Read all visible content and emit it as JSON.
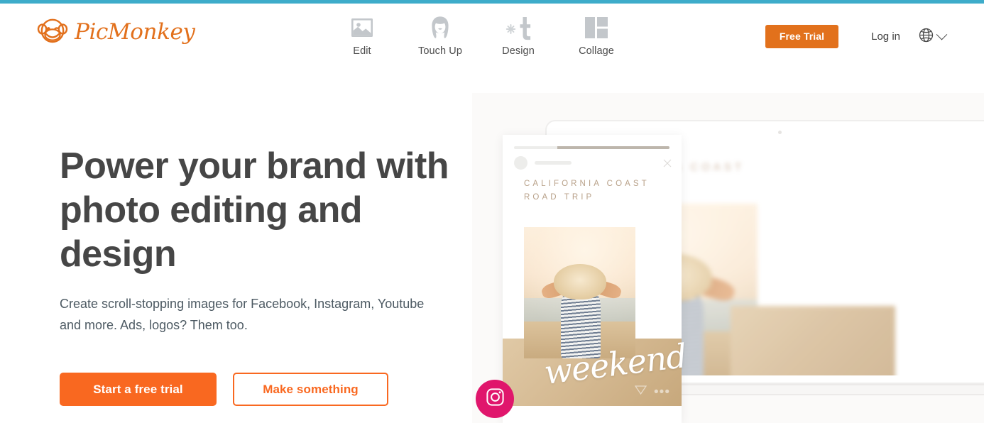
{
  "theme": {
    "accent_bar": "#3eacca",
    "brand_orange": "#F96820",
    "header_orange": "#e2711c",
    "logo_orange": "#e2701c",
    "instagram_pink": "#e0166c",
    "heading_gray": "#464646",
    "nav_icon_gray": "#c3c7cb"
  },
  "header": {
    "logo": {
      "text": "PicMonkey",
      "icon": "monkey-face-icon"
    },
    "nav": [
      {
        "label": "Edit",
        "icon": "image-photo-icon"
      },
      {
        "label": "Touch Up",
        "icon": "face-portrait-icon"
      },
      {
        "label": "Design",
        "icon": "asterisk-t-icon"
      },
      {
        "label": "Collage",
        "icon": "grid-panels-icon"
      }
    ],
    "free_trial_label": "Free Trial",
    "login_label": "Log in",
    "language": {
      "icon": "globe-icon",
      "chevron": "chevron-down-icon"
    }
  },
  "hero": {
    "title": "Power your brand with photo editing and design",
    "subtitle": "Create scroll-stopping images for Facebook, Instagram, Youtube and more. Ads, logos? Them too.",
    "primary_cta": "Start a free trial",
    "secondary_cta": "Make something"
  },
  "mockup": {
    "laptop": {
      "design_heading": "CALIFORNIA COAST\nROAD TRIP"
    },
    "instagram_card": {
      "design_heading": "CALIFORNIA COAST\nROAD TRIP",
      "script_word": "weekend",
      "send_icon": "paper-plane-icon",
      "more_icon": "ellipsis-icon",
      "close_icon": "close-x-icon",
      "avatar": "avatar-circle"
    },
    "badge": {
      "icon": "instagram-icon"
    }
  }
}
